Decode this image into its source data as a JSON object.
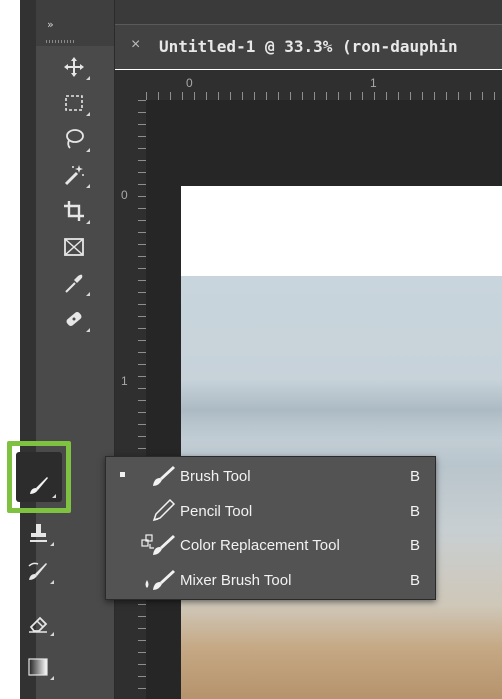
{
  "toolbar": {
    "collapse_label": "»",
    "tools": [
      {
        "name": "move-tool",
        "icon": "move-icon"
      },
      {
        "name": "marquee-tool",
        "icon": "rectangular-marquee-icon"
      },
      {
        "name": "lasso-tool",
        "icon": "lasso-icon"
      },
      {
        "name": "magic-wand-tool",
        "icon": "magic-wand-icon"
      },
      {
        "name": "crop-tool",
        "icon": "crop-icon"
      },
      {
        "name": "frame-tool",
        "icon": "frame-icon"
      },
      {
        "name": "eyedropper-tool",
        "icon": "eyedropper-icon"
      },
      {
        "name": "healing-brush-tool",
        "icon": "bandage-icon"
      },
      {
        "name": "brush-tool",
        "icon": "brush-icon",
        "active": true
      },
      {
        "name": "clone-stamp-tool",
        "icon": "stamp-icon"
      },
      {
        "name": "history-brush-tool",
        "icon": "history-brush-icon"
      },
      {
        "name": "eraser-tool",
        "icon": "eraser-icon"
      },
      {
        "name": "gradient-tool",
        "icon": "gradient-icon"
      }
    ],
    "highlight_color": "#7fc241"
  },
  "document": {
    "tab_close": "×",
    "tab_title": "Untitled-1 @ 33.3% (ron-dauphin",
    "ruler_h_labels": [
      "0",
      "1"
    ],
    "ruler_v_labels": [
      "0",
      "1"
    ]
  },
  "flyout": {
    "items": [
      {
        "label": "Brush Tool",
        "shortcut": "B",
        "icon": "brush-icon",
        "selected": true
      },
      {
        "label": "Pencil Tool",
        "shortcut": "B",
        "icon": "pencil-icon",
        "selected": false
      },
      {
        "label": "Color Replacement Tool",
        "shortcut": "B",
        "icon": "color-replacement-icon",
        "selected": false
      },
      {
        "label": "Mixer Brush Tool",
        "shortcut": "B",
        "icon": "mixer-brush-icon",
        "selected": false
      }
    ]
  }
}
